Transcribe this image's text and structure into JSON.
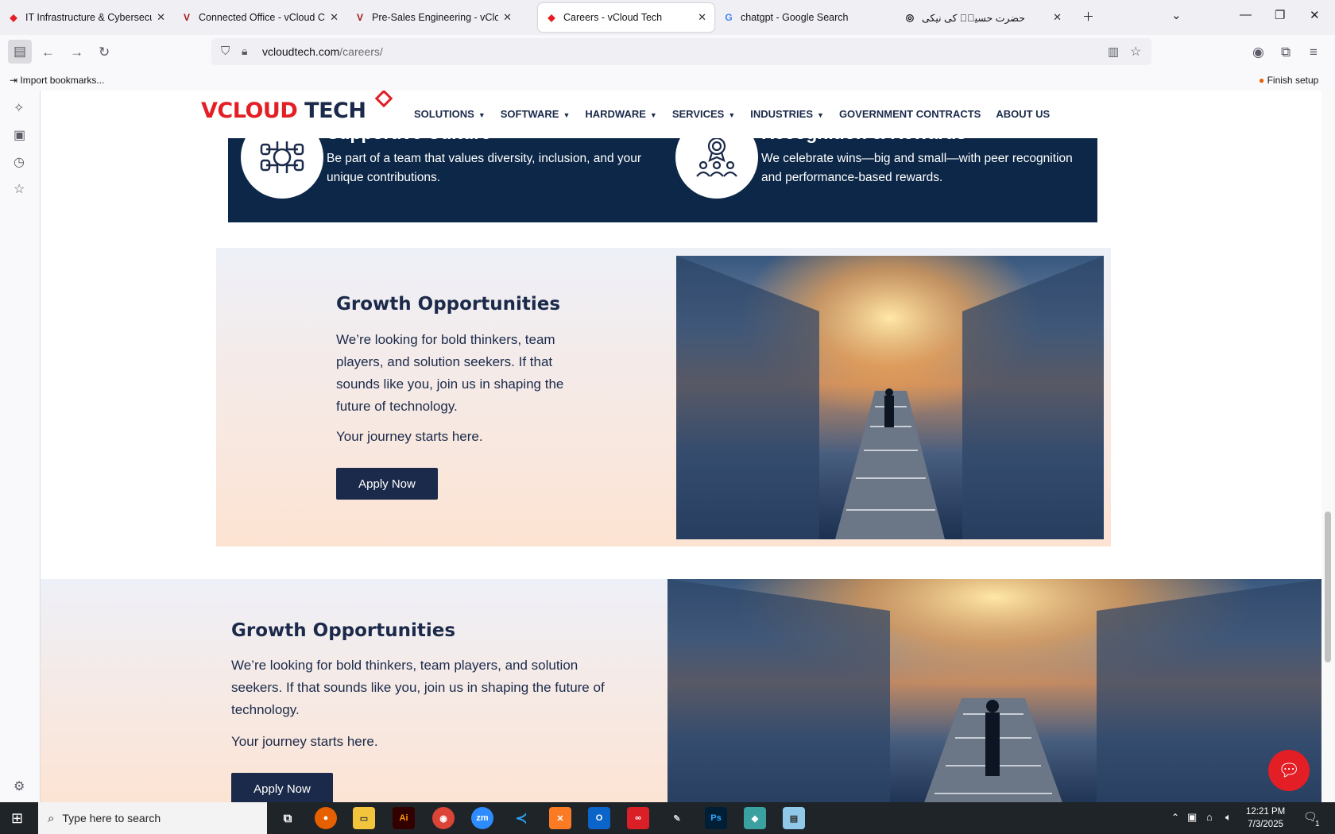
{
  "tabs": [
    {
      "label": "IT Infrastructure & Cybersecurity",
      "icon": "vcloud-icon"
    },
    {
      "label": "Connected Office - vCloud Choi",
      "icon": "vcloud-icon"
    },
    {
      "label": "Pre-Sales Engineering - vCloud",
      "icon": "vcloud-icon"
    },
    {
      "label": "Careers - vCloud Tech",
      "icon": "vcloud-icon",
      "active": true
    },
    {
      "label": "chatgpt - Google Search",
      "icon": "google-icon"
    },
    {
      "label": "حضرت حسینؓ کی نیکی",
      "icon": "chatgpt-icon"
    }
  ],
  "address": {
    "domain": "vcloudtech.com",
    "path": "/careers/"
  },
  "bookmarks": {
    "import_label": "Import bookmarks...",
    "finish_setup": "Finish setup"
  },
  "site": {
    "logo_v": "V",
    "logo_cloud": "CLOUD",
    "logo_tech": "TECH",
    "menu": [
      "SOLUTIONS",
      "SOFTWARE",
      "HARDWARE",
      "SERVICES",
      "INDUSTRIES",
      "GOVERNMENT CONTRACTS",
      "ABOUT US"
    ]
  },
  "culture": [
    {
      "title": "Supportive Culture",
      "desc": "Be part of a team that values diversity, inclusion, and your unique contributions.",
      "icon": "hands-circle-icon"
    },
    {
      "title": "Recognition & Rewards",
      "desc": "We celebrate wins—big and small—with peer recognition and performance-based rewards.",
      "icon": "award-team-icon"
    }
  ],
  "growth": {
    "title": "Growth Opportunities",
    "body": "We’re looking for bold thinkers, team players, and solution seekers. If that sounds like you, join us in shaping the future of technology.",
    "journey": "Your journey starts here.",
    "button": "Apply Now"
  },
  "taskbar": {
    "search_placeholder": "Type here to search",
    "time": "12:21 PM",
    "date": "7/3/2025",
    "notification_count": "1",
    "apps": [
      "firefox",
      "file-explorer",
      "illustrator",
      "chrome",
      "zoom",
      "vscode",
      "xampp",
      "outlook",
      "creative-cloud",
      "pen-tool",
      "photoshop",
      "app-blue",
      "notepad"
    ]
  },
  "colors": {
    "brand_red": "#e31e24",
    "brand_navy": "#1b2a4a",
    "band_navy": "#0c2747"
  }
}
